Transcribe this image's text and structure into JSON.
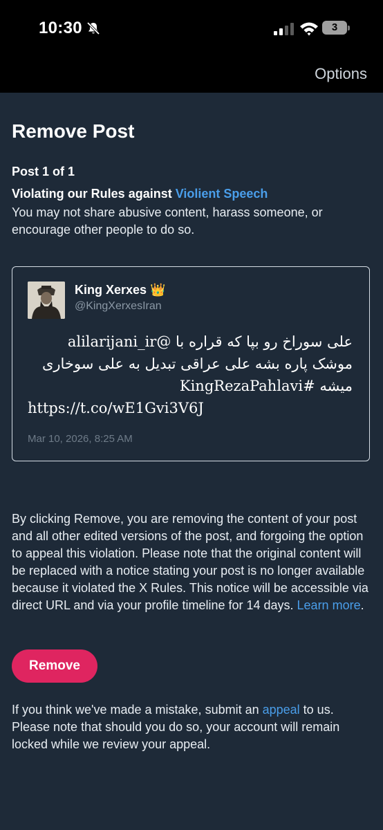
{
  "status_bar": {
    "time": "10:30",
    "battery": "3",
    "icons": [
      "bell-muted-icon",
      "signal-icon",
      "wifi-icon",
      "battery-icon"
    ]
  },
  "header": {
    "options_label": "Options"
  },
  "page": {
    "title": "Remove Post",
    "post_count": "Post 1 of 1",
    "violation_prefix": "Violating our Rules against ",
    "violation_link": "Violient Speech",
    "violation_desc": "You may not share abusive content, harass someone, or encourage other people to do so."
  },
  "tweet": {
    "author": "King Xerxes",
    "author_emoji": "👑",
    "handle": "@KingXerxesIran",
    "line1": "علی سوراخ رو بپا که قراره با @alilarijani_ir",
    "line2": "موشک پاره بشه علی عراقی تبدیل به علی سوخاری",
    "line3": "میشه #KingRezaPahlavi",
    "line4": "https://t.co/wE1Gvi3V6J",
    "date": "Mar 10, 2026, 8:25 AM"
  },
  "notice": {
    "text": "By clicking Remove, you are removing the content of your post and all other edited versions of the post, and forgoing the option to appeal this violation. Please note that the original content will be replaced with a notice stating your post is no longer available because it violated the X Rules. This notice will be accessible via direct URL and via your profile timeline for 14 days. ",
    "learn_more": "Learn more",
    "period": "."
  },
  "remove_button": "Remove",
  "appeal": {
    "prefix": "If you think we've made a mistake, submit an ",
    "link": "appeal",
    "suffix": " to us. Please note that should you do so, your account will remain locked while we review your appeal."
  },
  "colors": {
    "background": "#1e2a38",
    "link": "#4a9eea",
    "remove_button": "#df2560"
  }
}
